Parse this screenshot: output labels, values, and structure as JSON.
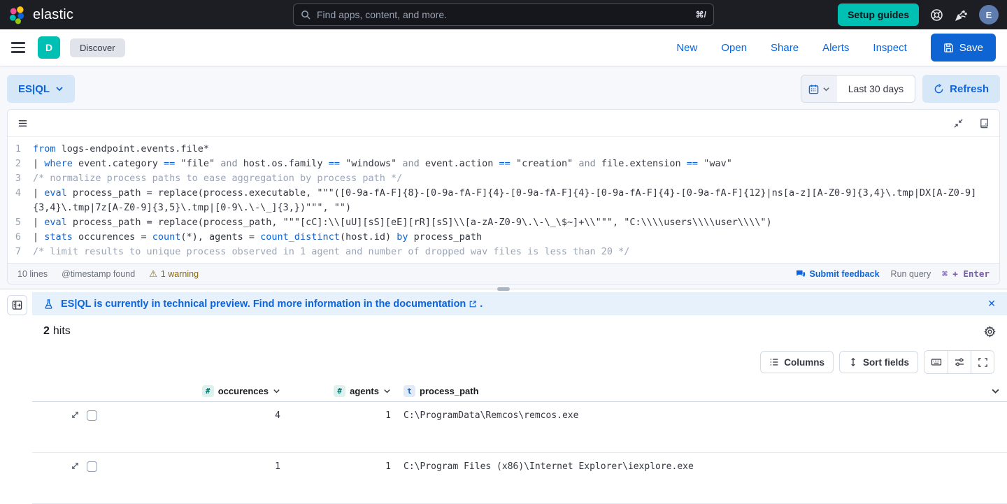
{
  "colors": {
    "brand_teal": "#00bfb3",
    "primary_blue": "#0b64dd",
    "warning_text": "#8a6a0b",
    "callout_bg": "#e7f1fb",
    "topbar_bg": "#1d1e24"
  },
  "top_bar": {
    "brand": "elastic",
    "search": {
      "placeholder": "Find apps, content, and more.",
      "shortcut": "⌘/"
    },
    "setup_guides_label": "Setup guides",
    "avatar_initial": "E"
  },
  "app_bar": {
    "space_initial": "D",
    "breadcrumb": "Discover",
    "menu": [
      "New",
      "Open",
      "Share",
      "Alerts",
      "Inspect"
    ],
    "save_label": "Save"
  },
  "query_bar": {
    "mode_label": "ES|QL",
    "time_range": "Last 30 days",
    "refresh_label": "Refresh"
  },
  "editor": {
    "lines": [
      {
        "n": "1",
        "toks": [
          [
            "k",
            "from"
          ],
          [
            "p",
            " logs-endpoint.events.file*"
          ]
        ]
      },
      {
        "n": "2",
        "toks": [
          [
            "p",
            "| "
          ],
          [
            "k",
            "where"
          ],
          [
            "p",
            " event.category "
          ],
          [
            "k",
            "=="
          ],
          [
            "p",
            " \"file\" "
          ],
          [
            "a",
            "and"
          ],
          [
            "p",
            " host.os.family "
          ],
          [
            "k",
            "=="
          ],
          [
            "p",
            " \"windows\" "
          ],
          [
            "a",
            "and"
          ],
          [
            "p",
            " event.action "
          ],
          [
            "k",
            "=="
          ],
          [
            "p",
            " \"creation\" "
          ],
          [
            "a",
            "and"
          ],
          [
            "p",
            " file.extension "
          ],
          [
            "k",
            "=="
          ],
          [
            "p",
            " \"wav\""
          ]
        ]
      },
      {
        "n": "3",
        "toks": [
          [
            "c",
            "/* normalize process paths to ease aggregation by process path */"
          ]
        ]
      },
      {
        "n": "4",
        "toks": [
          [
            "p",
            "| "
          ],
          [
            "k",
            "eval"
          ],
          [
            "p",
            " process_path = replace(process.executable, \"\"\"([0-9a-fA-F]{8}-[0-9a-fA-F]{4}-[0-9a-fA-F]{4}-[0-9a-fA-F]{4}-[0-9a-fA-F]{12}|ns[a-z][A-Z0-9]{3,4}\\.tmp|DX[A-Z0-9]{3,4}\\.tmp|7z[A-Z0-9]{3,5}\\.tmp|[0-9\\.\\-\\_]{3,})\"\"\", \"\")"
          ]
        ]
      },
      {
        "n": "5",
        "toks": [
          [
            "p",
            "| "
          ],
          [
            "k",
            "eval"
          ],
          [
            "p",
            " process_path = replace(process_path, \"\"\"[cC]:\\\\[uU][sS][eE][rR][sS]\\\\[a-zA-Z0-9\\.\\-\\_\\$~]+\\\\\"\"\", \"C:\\\\\\\\users\\\\\\\\user\\\\\\\\\")"
          ]
        ]
      },
      {
        "n": "6",
        "toks": [
          [
            "p",
            "| "
          ],
          [
            "k",
            "stats"
          ],
          [
            "p",
            " occurences = "
          ],
          [
            "k",
            "count"
          ],
          [
            "p",
            "(*), agents = "
          ],
          [
            "k",
            "count_distinct"
          ],
          [
            "p",
            "(host.id) "
          ],
          [
            "k",
            "by"
          ],
          [
            "p",
            " process_path"
          ]
        ]
      },
      {
        "n": "7",
        "toks": [
          [
            "c",
            "/* limit results to unique process observed in 1 agent and number of dropped wav files is less than 20 */"
          ]
        ]
      }
    ],
    "footer": {
      "lines_count": "10 lines",
      "timestamp_status": "@timestamp found",
      "warning": "1 warning",
      "warning_glyph": "⚠",
      "feedback_label": "Submit feedback",
      "run_query_label": "Run query",
      "shortcut_mod": "⌘",
      "shortcut_plus": "+",
      "shortcut_key": "Enter"
    }
  },
  "preview_banner": {
    "text_before": "ES|QL is currently in technical preview. Find more information in the ",
    "link_text": "documentation",
    "text_after": ".",
    "close_glyph": "✕"
  },
  "results": {
    "hits_count": "2",
    "hits_label": "hits",
    "toolbar": {
      "columns_label": "Columns",
      "sort_fields_label": "Sort fields"
    },
    "table": {
      "columns": [
        {
          "badge": "#",
          "label": "occurences"
        },
        {
          "badge": "#",
          "label": "agents"
        },
        {
          "badge": "t",
          "label": "process_path"
        }
      ],
      "rows": [
        {
          "occurences": "4",
          "agents": "1",
          "process_path": "C:\\ProgramData\\Remcos\\remcos.exe"
        },
        {
          "occurences": "1",
          "agents": "1",
          "process_path": "C:\\Program Files (x86)\\Internet Explorer\\iexplore.exe"
        }
      ]
    }
  }
}
